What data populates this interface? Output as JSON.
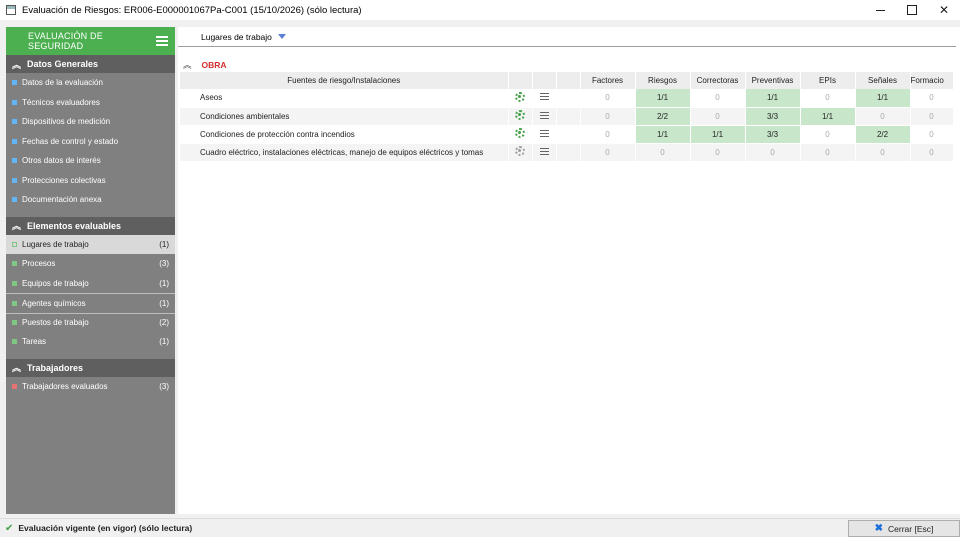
{
  "window": {
    "title": "Evaluación de Riesgos: ER006-E000001067Pa-C001  (15/10/2026)  (sólo lectura)"
  },
  "sidebar": {
    "header": "EVALUACIÓN DE SEGURIDAD",
    "sections": [
      {
        "title": "Datos Generales",
        "items": [
          {
            "label": "Datos de la evaluación",
            "count": "",
            "color": "#64b5f6"
          },
          {
            "label": "Técnicos evaluadores",
            "count": "",
            "color": "#64b5f6"
          },
          {
            "label": "Dispositivos de medición",
            "count": "",
            "color": "#64b5f6"
          },
          {
            "label": "Fechas de control y estado",
            "count": "",
            "color": "#64b5f6"
          },
          {
            "label": "Otros datos de interés",
            "count": "",
            "color": "#64b5f6"
          },
          {
            "label": "Protecciones colectivas",
            "count": "",
            "color": "#64b5f6"
          },
          {
            "label": "Documentación anexa",
            "count": "",
            "color": "#64b5f6"
          }
        ]
      },
      {
        "title": "Elementos evaluables",
        "items": [
          {
            "label": "Lugares de trabajo",
            "count": "(1)",
            "color": "#81c784"
          },
          {
            "label": "Procesos",
            "count": "(3)",
            "color": "#81c784"
          },
          {
            "label": "Equipos de trabajo",
            "count": "(1)",
            "color": "#81c784"
          },
          {
            "label": "Agentes químicos",
            "count": "(1)",
            "color": "#81c784"
          },
          {
            "label": "Puestos de trabajo",
            "count": "(2)",
            "color": "#81c784"
          },
          {
            "label": "Tareas",
            "count": "(1)",
            "color": "#81c784"
          }
        ]
      },
      {
        "title": "Trabajadores",
        "items": [
          {
            "label": "Trabajadores evaluados",
            "count": "(3)",
            "color": "#e57373"
          }
        ]
      }
    ]
  },
  "main": {
    "dropdown_label": "Lugares de trabajo",
    "group_label": "OBRA",
    "table": {
      "headers": [
        "Fuentes de riesgo/Instalaciones",
        "",
        "",
        "",
        "Factores",
        "Riesgos",
        "Correctoras",
        "Preventivas",
        "EPIs",
        "Señales",
        "Formacio"
      ],
      "rows": [
        {
          "name": "Aseos",
          "gear": "active",
          "values": [
            "0",
            "1/1",
            "0",
            "1/1",
            "0",
            "1/1",
            "0"
          ]
        },
        {
          "name": "Condiciones ambientales",
          "gear": "active",
          "values": [
            "0",
            "2/2",
            "0",
            "3/3",
            "1/1",
            "0",
            "0"
          ]
        },
        {
          "name": "Condiciones de protección contra incendios",
          "gear": "active",
          "values": [
            "0",
            "1/1",
            "1/1",
            "3/3",
            "0",
            "2/2",
            "0"
          ]
        },
        {
          "name": "Cuadro eléctrico, instalaciones eléctricas, manejo de equipos eléctricos y tomas",
          "gear": "inactive",
          "values": [
            "0",
            "0",
            "0",
            "0",
            "0",
            "0",
            "0"
          ]
        }
      ]
    }
  },
  "status": {
    "text": "Evaluación vigente (en vigor) (sólo lectura)",
    "close_label": "Cerrar  [Esc]"
  }
}
